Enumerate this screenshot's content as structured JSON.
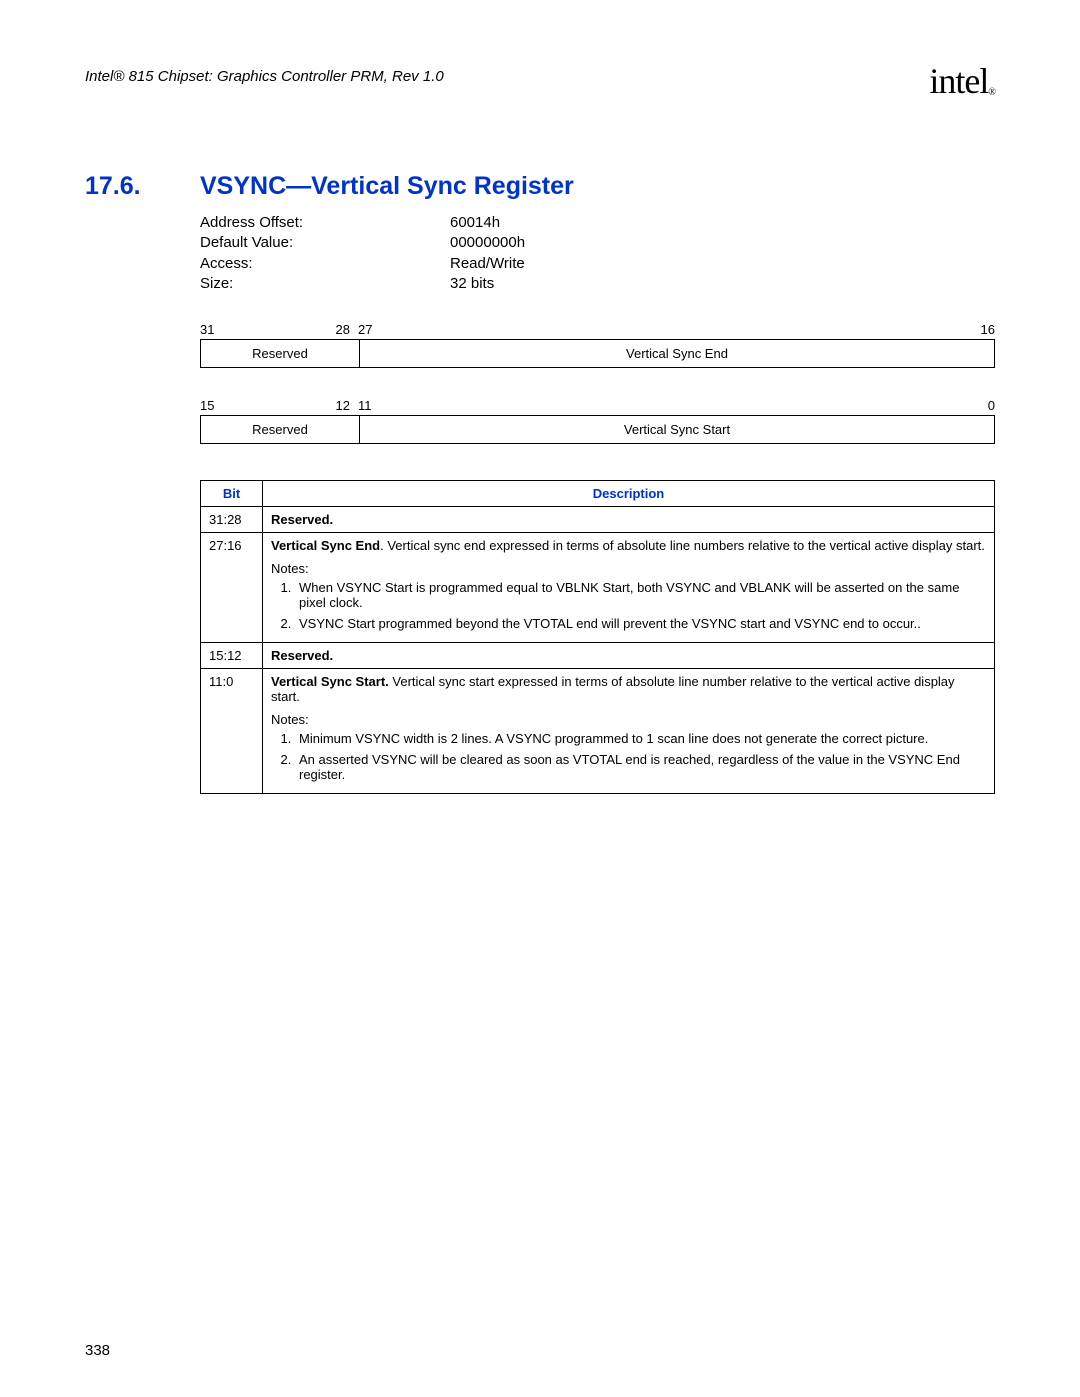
{
  "header": {
    "doc_title": "Intel® 815 Chipset: Graphics Controller PRM, Rev 1.0",
    "logo_text": "intel",
    "logo_reg": "®"
  },
  "section": {
    "number": "17.6.",
    "title": "VSYNC—Vertical Sync Register"
  },
  "properties": {
    "labels": {
      "address_offset": "Address Offset:",
      "default_value": "Default Value:",
      "access": "Access:",
      "size": "Size:"
    },
    "values": {
      "address_offset": "60014h",
      "default_value": "00000000h",
      "access": "Read/Write",
      "size": "32 bits"
    }
  },
  "bit_diagram": {
    "upper": {
      "left_hi": "31",
      "left_lo": "28",
      "right_hi": "27",
      "right_lo": "16",
      "cell_a": "Reserved",
      "cell_b": "Vertical Sync End"
    },
    "lower": {
      "left_hi": "15",
      "left_lo": "12",
      "right_hi": "11",
      "right_lo": "0",
      "cell_a": "Reserved",
      "cell_b": "Vertical Sync Start"
    }
  },
  "table": {
    "headers": {
      "bit": "Bit",
      "description": "Description"
    },
    "rows": {
      "r0": {
        "bit": "31:28",
        "desc_bold": "Reserved."
      },
      "r1": {
        "bit": "27:16",
        "desc_bold": "Vertical Sync End",
        "desc_rest": ". Vertical sync end expressed in terms of absolute line numbers relative to the vertical active display start.",
        "notes_label": "Notes:",
        "note1": "When VSYNC Start is programmed equal to VBLNK Start, both VSYNC and VBLANK will be asserted on the same pixel clock.",
        "note2": "VSYNC Start programmed beyond the VTOTAL end will prevent the VSYNC start and VSYNC end to occur.."
      },
      "r2": {
        "bit": "15:12",
        "desc_bold": "Reserved."
      },
      "r3": {
        "bit": "11:0",
        "desc_bold": "Vertical Sync Start.",
        "desc_rest": " Vertical sync start expressed in terms of absolute line number relative to the vertical active display start.",
        "notes_label": "Notes:",
        "note1": "Minimum VSYNC width is 2 lines. A VSYNC programmed to 1 scan line does not generate the correct picture.",
        "note2": "An asserted VSYNC will be cleared as soon as VTOTAL end is reached, regardless of the value in the VSYNC End register."
      }
    }
  },
  "page_number": "338"
}
